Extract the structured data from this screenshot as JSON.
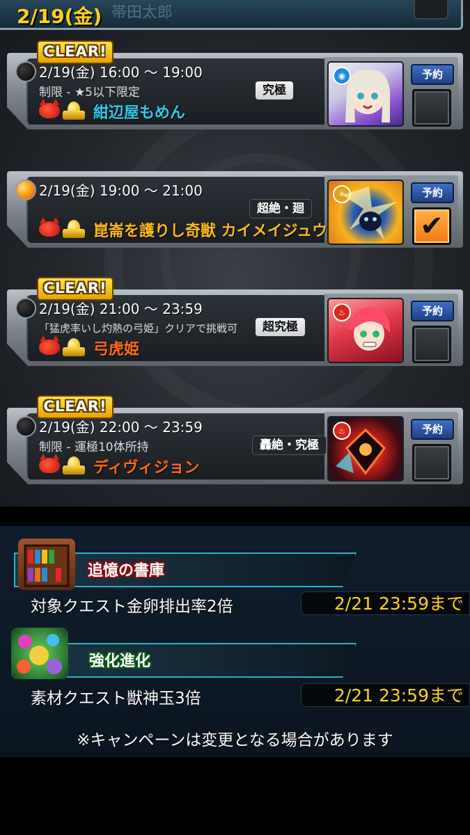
{
  "header": {
    "date": "2/19(金)",
    "ghost_text": "帯田太郎"
  },
  "events": [
    {
      "clear_label": "CLEAR!",
      "lamp": "off",
      "time": "2/19(金) 16:00 ～ 19:00",
      "condition": "制限 - ★5以下限定",
      "difficulty": "究極",
      "quest_name": "紺辺屋もめん",
      "quest_color": "#33c9e8",
      "element_icon": "water-element-icon",
      "reserve_label": "予約",
      "checked": false,
      "check_mark": ""
    },
    {
      "clear_label": "",
      "lamp": "on",
      "time": "2/19(金) 19:00 ～ 21:00",
      "condition": "",
      "difficulty": "超絶・廻",
      "quest_name": "崑崙を護りし奇獣 カイメイジュウ廻",
      "quest_color": "#ffb820",
      "element_icon": "light-element-icon",
      "reserve_label": "予約",
      "checked": true,
      "check_mark": "✔"
    },
    {
      "clear_label": "CLEAR!",
      "lamp": "off",
      "time": "2/19(金) 21:00 ～ 23:59",
      "condition": "「猛虎率いし灼熱の弓姫」クリアで挑戦可",
      "difficulty": "超究極",
      "quest_name": "弓虎姫",
      "quest_color": "#ff6a1a",
      "element_icon": "fire-element-icon",
      "reserve_label": "予約",
      "checked": false,
      "check_mark": ""
    },
    {
      "clear_label": "CLEAR!",
      "lamp": "off",
      "time": "2/19(金) 22:00 ～ 23:59",
      "condition": "制限 - 運極10体所持",
      "difficulty": "轟絶・究極",
      "quest_name": "ディヴィジョン",
      "quest_color": "#ff6a1a",
      "element_icon": "fire-element-icon",
      "reserve_label": "予約",
      "checked": false,
      "check_mark": ""
    }
  ],
  "campaigns": [
    {
      "title": "追憶の書庫",
      "description": "対象クエスト金卵排出率2倍",
      "deadline": "2/21 23:59まで",
      "icon": "bookshelf-icon"
    },
    {
      "title": "強化進化",
      "description": "素材クエスト獣神玉3倍",
      "deadline": "2/21 23:59まで",
      "icon": "evolution-materials-icon"
    }
  ],
  "note": "※キャンペーンは変更となる場合があります",
  "colors": {
    "date_yellow": "#ffd21a",
    "reserve_blue": "#2f5bb0",
    "check_orange": "#f58a1a",
    "campaign_border": "#2fb0c8"
  }
}
